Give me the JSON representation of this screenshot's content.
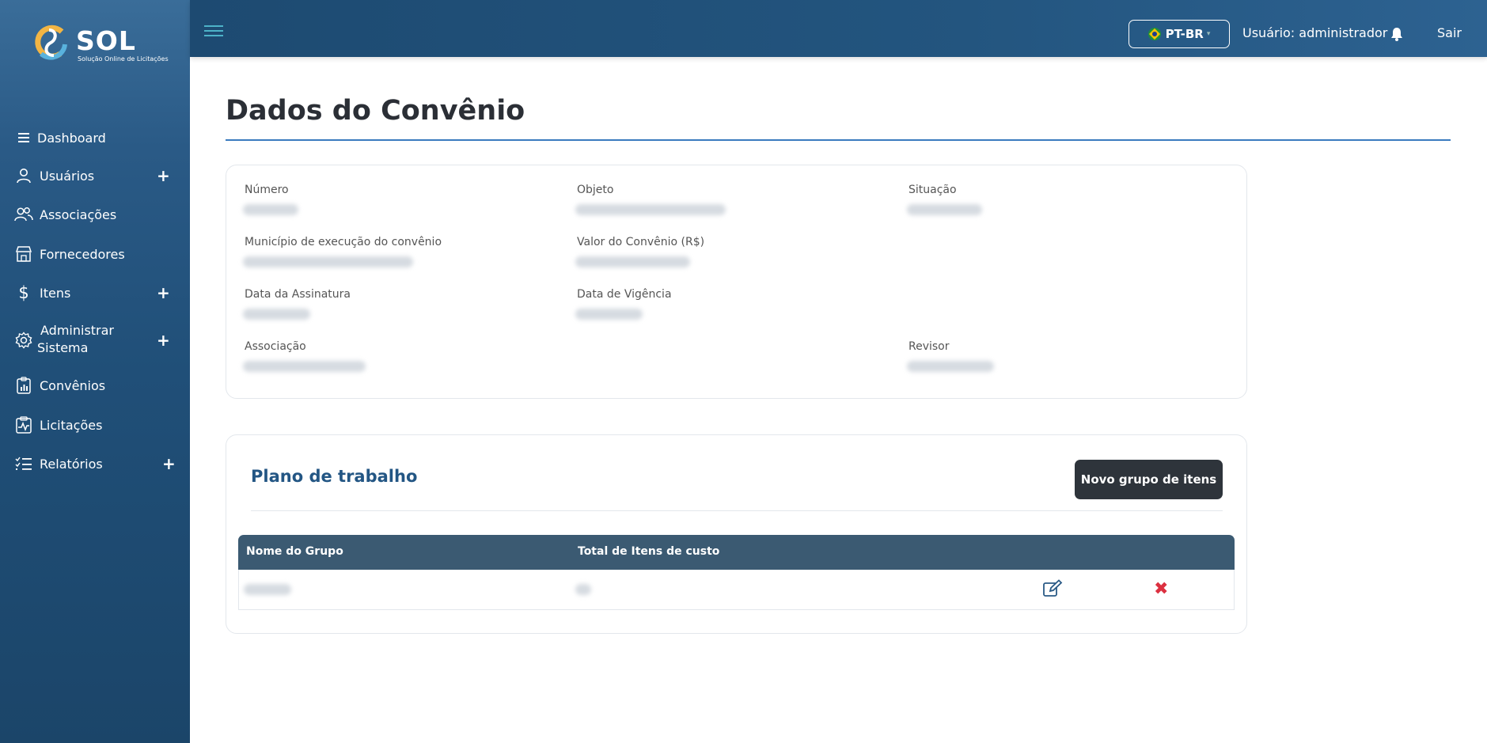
{
  "brand": {
    "name": "SOL",
    "tagline": "Solução Online de Licitações"
  },
  "sidebar": {
    "items": [
      {
        "label": "Dashboard",
        "icon": "menu-icon",
        "expandable": false
      },
      {
        "label": "Usuários",
        "icon": "user-icon",
        "expandable": true
      },
      {
        "label": "Associações",
        "icon": "users-icon",
        "expandable": false
      },
      {
        "label": "Fornecedores",
        "icon": "store-icon",
        "expandable": false
      },
      {
        "label": "Itens",
        "icon": "dollar-icon",
        "expandable": true
      },
      {
        "label": "Administrar",
        "label2": "Sistema",
        "icon": "gear-icon",
        "expandable": true
      },
      {
        "label": "Convênios",
        "icon": "report-icon",
        "expandable": false
      },
      {
        "label": "Licitações",
        "icon": "chart-doc-icon",
        "expandable": false
      },
      {
        "label": "Relatórios",
        "icon": "list-icon",
        "expandable": true
      }
    ],
    "plus": "+"
  },
  "header": {
    "language": "PT-BR",
    "user_text": "Usuário: administrador",
    "logout": "Sair"
  },
  "page": {
    "title": "Dados do Convênio"
  },
  "details": {
    "numero_label": "Número",
    "objeto_label": "Objeto",
    "situacao_label": "Situação",
    "municipio_label": "Município de execução do convênio",
    "valor_label": "Valor do Convênio (R$)",
    "data_assinatura_label": "Data da Assinatura",
    "data_vigencia_label": "Data de Vigência",
    "associacao_label": "Associação",
    "revisor_label": "Revisor"
  },
  "plano": {
    "title": "Plano de trabalho",
    "new_button": "Novo grupo de itens",
    "columns": [
      "Nome do Grupo",
      "Total de Itens de custo"
    ]
  },
  "colors": {
    "sidebar": "#204f78",
    "accent": "#3a7bbf",
    "table_header": "#3b5a72",
    "delete": "#dc3040"
  }
}
